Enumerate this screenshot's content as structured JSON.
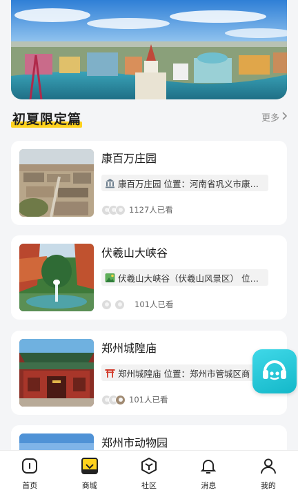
{
  "section": {
    "title": "初夏限定篇",
    "more_label": "更多"
  },
  "cards": [
    {
      "title": "康百万庄园",
      "location": "康百万庄园 位置：河南省巩义市康…",
      "location_icon": "museum-icon",
      "views": "1127人已看"
    },
    {
      "title": "伏羲山大峡谷",
      "location": "伏羲山大峡谷（伏羲山风景区） 位…",
      "location_icon": "landscape-photo-icon",
      "views": "101人已看"
    },
    {
      "title": "郑州城隍庙",
      "location": "郑州城隍庙 位置：郑州市管城区商",
      "location_icon": "torii-gate-icon",
      "views": "101人已看"
    },
    {
      "title": "郑州市动物园"
    }
  ],
  "tabbar": [
    {
      "label": "首页",
      "icon": "home-icon"
    },
    {
      "label": "商城",
      "icon": "mall-icon",
      "active": true
    },
    {
      "label": "社区",
      "icon": "community-icon"
    },
    {
      "label": "消息",
      "icon": "bell-icon"
    },
    {
      "label": "我的",
      "icon": "profile-icon"
    }
  ],
  "colors": {
    "accent": "#ffd21e",
    "service_button": "#1fc4d6",
    "background": "#f4f5f7"
  }
}
